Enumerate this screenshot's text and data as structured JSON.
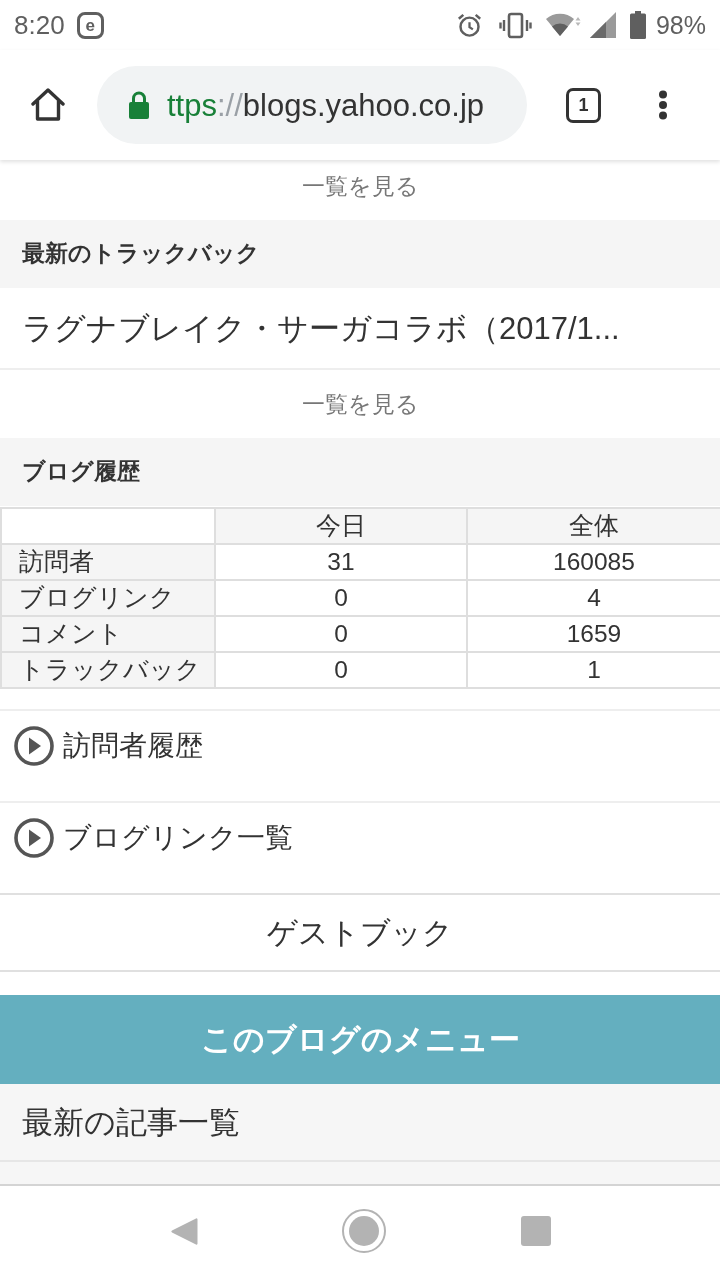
{
  "status_bar": {
    "time": "8:20",
    "notification_icon": "e",
    "battery": "98%"
  },
  "toolbar": {
    "url": {
      "scheme": "ttps",
      "separator": "://",
      "host": "blogs.yahoo.co.jp"
    },
    "tab_count": "1"
  },
  "top_more_link": "一覧を見る",
  "trackback_section": {
    "heading": "最新のトラックバック",
    "items": [
      "ラグナブレイク・サーガコラボ（2017/1..."
    ],
    "more_link": "一覧を見る"
  },
  "history_section": {
    "heading": "ブログ履歴",
    "table": {
      "columns": [
        "今日",
        "全体"
      ],
      "rows": [
        {
          "label": "訪問者",
          "values": [
            "31",
            "160085"
          ]
        },
        {
          "label": "ブログリンク",
          "values": [
            "0",
            "4"
          ]
        },
        {
          "label": "コメント",
          "values": [
            "0",
            "1659"
          ]
        },
        {
          "label": "トラックバック",
          "values": [
            "0",
            "1"
          ]
        }
      ]
    }
  },
  "links": [
    {
      "kind": "expandable",
      "label": "訪問者履歴"
    },
    {
      "kind": "expandable",
      "label": "ブログリンク一覧"
    },
    {
      "kind": "centered",
      "label": "ゲストブック"
    }
  ],
  "blog_menu": {
    "title": "このブログのメニュー",
    "items": [
      "最新の記事一覧"
    ]
  }
}
